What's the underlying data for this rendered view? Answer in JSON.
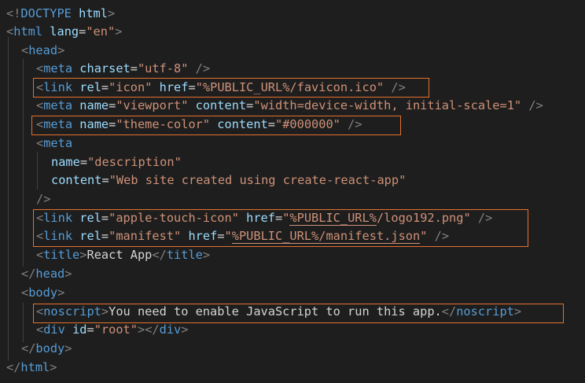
{
  "code": {
    "doctype": {
      "open": "<!",
      "keyword": "DOCTYPE",
      "name": "html",
      "close": ">"
    },
    "html_open": {
      "tag": "html",
      "attr": "lang",
      "value": "\"en\""
    },
    "head_open": "head",
    "meta_charset": {
      "tag": "meta",
      "attr": "charset",
      "value": "\"utf-8\""
    },
    "link_icon": {
      "tag": "link",
      "attr1": "rel",
      "val1": "\"icon\"",
      "attr2": "href",
      "val2": "\"%PUBLIC_URL%/favicon.ico\""
    },
    "meta_viewport": {
      "tag": "meta",
      "attr1": "name",
      "val1": "\"viewport\"",
      "attr2": "content",
      "val2": "\"width=device-width, initial-scale=1\""
    },
    "meta_theme": {
      "tag": "meta",
      "attr1": "name",
      "val1": "\"theme-color\"",
      "attr2": "content",
      "val2": "\"#000000\""
    },
    "meta_desc": {
      "tag": "meta",
      "attr1": "name",
      "val1": "\"description\"",
      "attr2": "content",
      "val2": "\"Web site created using create-react-app\""
    },
    "link_apple": {
      "tag": "link",
      "attr1": "rel",
      "val1": "\"apple-touch-icon\"",
      "attr2": "href",
      "val2_q": "\"",
      "val2_ul": "%PUBLIC_URL%",
      "val2_rest": "/logo192.png\""
    },
    "link_manifest": {
      "tag": "link",
      "attr1": "rel",
      "val1": "\"manifest\"",
      "attr2": "href",
      "val2_q": "\"",
      "val2_ul": "%PUBLIC_URL%/manifest.json",
      "val2_rest": "\""
    },
    "title": {
      "tag": "title",
      "text": "React App"
    },
    "body_open": "body",
    "noscript": {
      "tag": "noscript",
      "text": "You need to enable JavaScript to run this app."
    },
    "div_root": {
      "tag": "div",
      "attr": "id",
      "value": "\"root\""
    }
  },
  "colors": {
    "background": "#1e1e1e",
    "tag": "#569cd6",
    "bracket": "#808080",
    "attribute": "#9cdcfe",
    "string": "#ce9178",
    "text": "#d4d4d4",
    "highlight_box": "#e5712e"
  }
}
